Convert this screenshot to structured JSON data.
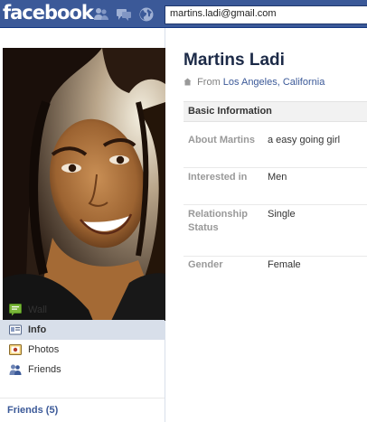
{
  "topbar": {
    "logo": "facebook",
    "jewels": [
      "friend-requests-icon",
      "messages-icon",
      "notifications-globe-icon"
    ],
    "search_value": "martins.ladi@gmail.com",
    "color": "#3b5998"
  },
  "sidebar": {
    "photo_alt": "profile-photo",
    "items": [
      {
        "label": "Wall",
        "icon": "wall-icon",
        "active": false
      },
      {
        "label": "Info",
        "icon": "info-icon",
        "active": true
      },
      {
        "label": "Photos",
        "icon": "photos-icon",
        "active": false
      },
      {
        "label": "Friends",
        "icon": "friends-icon",
        "active": false
      }
    ],
    "friends_link": "Friends (5)"
  },
  "profile": {
    "name": "Martins Ladi",
    "from_prefix": "From",
    "from_location": "Los Angeles, California"
  },
  "basic_info": {
    "header": "Basic Information",
    "rows": [
      {
        "label": "About Martins",
        "value": "a easy going girl"
      },
      {
        "label": "Interested in",
        "value": "Men"
      },
      {
        "label": "Relationship Status",
        "value": "Single"
      },
      {
        "label": "Gender",
        "value": "Female"
      }
    ]
  }
}
